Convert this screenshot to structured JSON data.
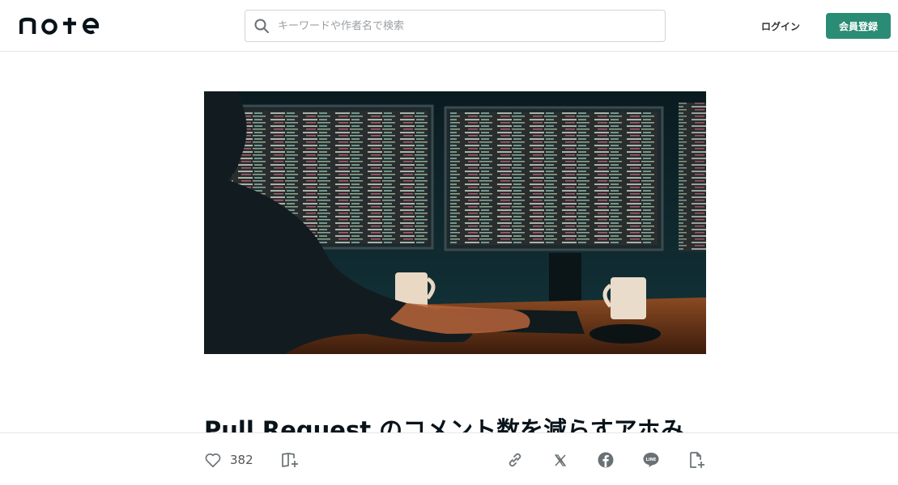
{
  "header": {
    "logo_text": "note",
    "search": {
      "placeholder": "キーワードや作者名で検索",
      "value": ""
    },
    "login_label": "ログイン",
    "signup_label": "会員登録"
  },
  "article": {
    "title": "Pull Request のコメント数を減らすアホみ"
  },
  "actions": {
    "like_count": "382",
    "icons": [
      "heart-icon",
      "magazine-add-icon",
      "link-icon",
      "x-icon",
      "facebook-icon",
      "line-icon",
      "embed-add-icon"
    ]
  },
  "colors": {
    "accent": "#2a8c74",
    "text": "#08131a",
    "icon": "#6a7174"
  }
}
